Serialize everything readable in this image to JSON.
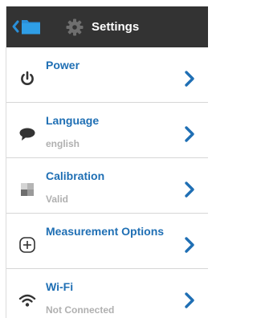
{
  "header": {
    "title": "Settings",
    "back_icon": "chevron-left-icon",
    "folder_icon": "folder-icon",
    "settings_icon": "gear-icon"
  },
  "settings_list": [
    {
      "title": "Power",
      "subtitle": "",
      "icon": "power-icon"
    },
    {
      "title": "Language",
      "subtitle": "english",
      "icon": "speech-bubble-icon"
    },
    {
      "title": "Calibration",
      "subtitle": "Valid",
      "icon": "calibration-icon"
    },
    {
      "title": "Measurement Options",
      "subtitle": "",
      "icon": "crosshair-icon"
    },
    {
      "title": "Wi-Fi",
      "subtitle": "Not Connected",
      "icon": "wifi-icon"
    }
  ],
  "colors": {
    "header_bg": "#333333",
    "accent": "#1f6fb4",
    "subtitle": "#b0b0b0"
  }
}
